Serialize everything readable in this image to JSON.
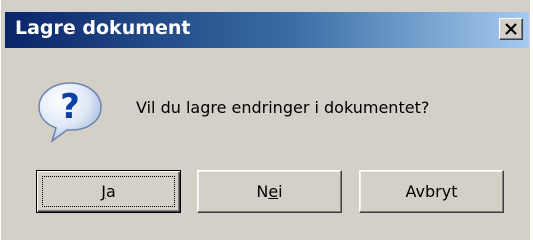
{
  "window": {
    "title": "Lagre dokument",
    "close_icon": "close-icon"
  },
  "message": {
    "icon": "question-icon",
    "text": "Vil du lagre endringer i dokumentet?"
  },
  "buttons": {
    "yes": {
      "pre": "",
      "mnemonic": "J",
      "post": "a"
    },
    "no": {
      "pre": "N",
      "mnemonic": "e",
      "post": "i"
    },
    "cancel": {
      "label": "Avbryt"
    }
  },
  "colors": {
    "titlebar_start": "#0a246a",
    "titlebar_end": "#a6caf0",
    "dialog_background": "#d4d0c8"
  }
}
